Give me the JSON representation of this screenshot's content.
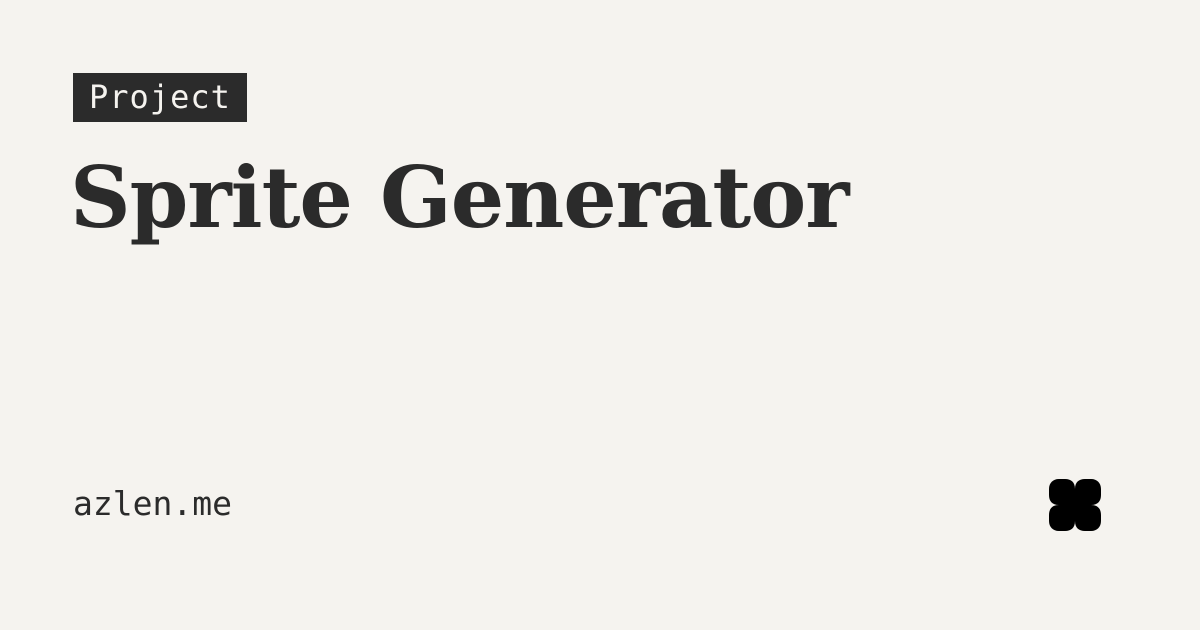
{
  "card": {
    "tag": "Project",
    "title": "Sprite Generator",
    "site": "azlen.me",
    "logo_icon": "clover-logo-icon"
  },
  "colors": {
    "background": "#f5f3ef",
    "text": "#2b2b2b",
    "tag_background": "#2b2b2b",
    "tag_text": "#f5f3ef",
    "logo": "#000000"
  }
}
